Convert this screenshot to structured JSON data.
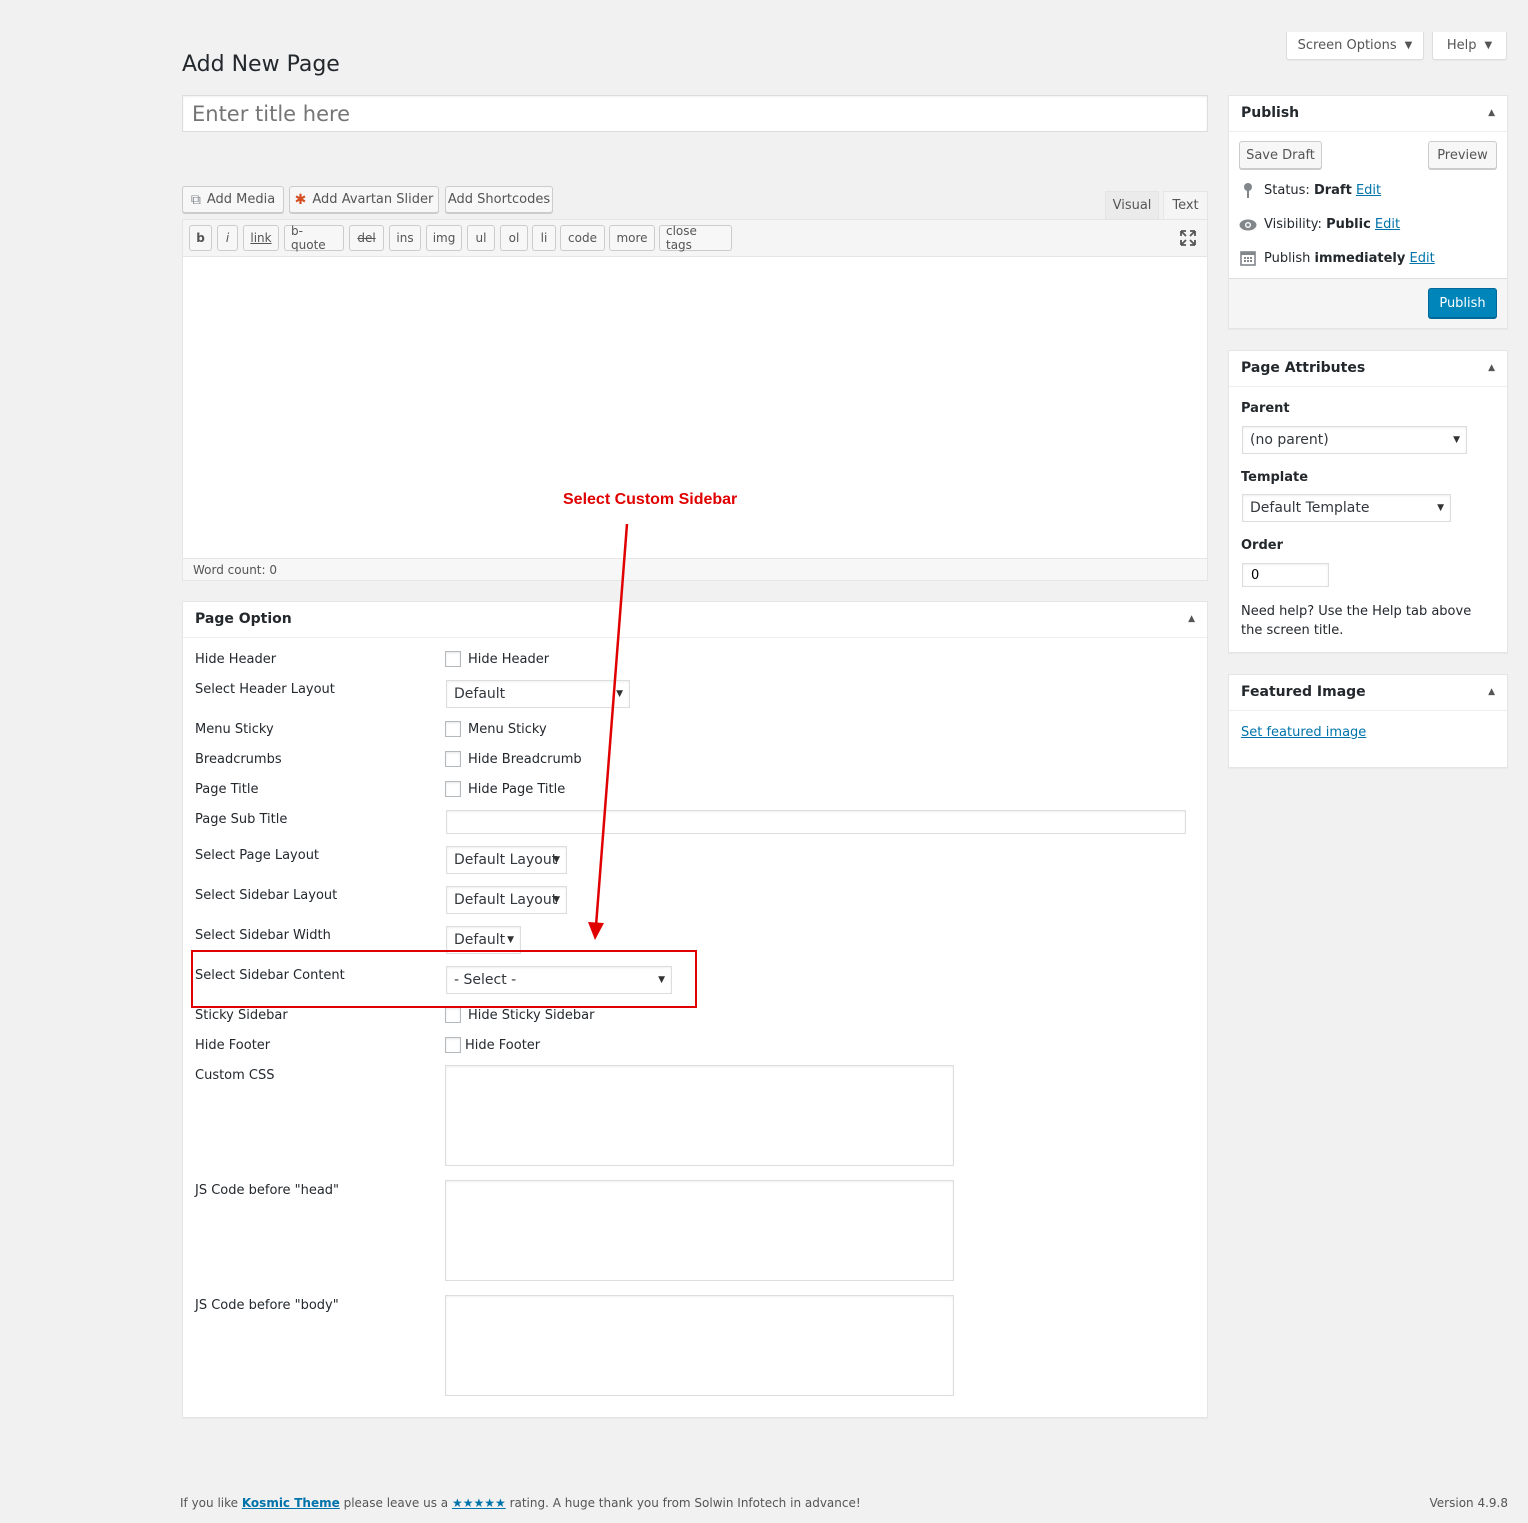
{
  "header": {
    "title": "Add New Page",
    "screen_options": "Screen Options",
    "help": "Help"
  },
  "title_input": {
    "placeholder": "Enter title here",
    "value": ""
  },
  "media_buttons": {
    "add_media": "Add Media",
    "add_slider": "Add Avartan Slider",
    "add_shortcodes": "Add Shortcodes"
  },
  "editor_tabs": {
    "visual": "Visual",
    "text": "Text"
  },
  "quicktags": [
    "b",
    "i",
    "link",
    "b-quote",
    "del",
    "ins",
    "img",
    "ul",
    "ol",
    "li",
    "code",
    "more",
    "close tags"
  ],
  "word_count": "Word count: 0",
  "page_option": {
    "title": "Page Option",
    "rows": {
      "hide_header": {
        "label": "Hide Header",
        "checkbox": "Hide Header"
      },
      "header_layout": {
        "label": "Select Header Layout",
        "value": "Default"
      },
      "menu_sticky": {
        "label": "Menu Sticky",
        "checkbox": "Menu Sticky"
      },
      "breadcrumbs": {
        "label": "Breadcrumbs",
        "checkbox": "Hide Breadcrumb"
      },
      "page_title": {
        "label": "Page Title",
        "checkbox": "Hide Page Title"
      },
      "page_sub_title": {
        "label": "Page Sub Title",
        "value": ""
      },
      "page_layout": {
        "label": "Select Page Layout",
        "value": "Default Layout"
      },
      "sidebar_layout": {
        "label": "Select Sidebar Layout",
        "value": "Default Layout"
      },
      "sidebar_width": {
        "label": "Select Sidebar Width",
        "value": "Default"
      },
      "sidebar_content": {
        "label": "Select Sidebar Content",
        "value": "- Select -"
      },
      "sticky_sidebar": {
        "label": "Sticky Sidebar",
        "checkbox": "Hide Sticky Sidebar"
      },
      "hide_footer": {
        "label": "Hide Footer",
        "checkbox": "Hide Footer"
      },
      "custom_css": {
        "label": "Custom CSS"
      },
      "js_head": {
        "label": "JS Code before \"head\""
      },
      "js_body": {
        "label": "JS Code before \"body\""
      }
    }
  },
  "annotation": {
    "text": "Select Custom Sidebar",
    "color": "#e00000"
  },
  "publish": {
    "title": "Publish",
    "save_draft": "Save Draft",
    "preview": "Preview",
    "status_label": "Status:",
    "status_value": "Draft",
    "visibility_label": "Visibility:",
    "visibility_value": "Public",
    "publish_label": "Publish",
    "publish_value": "immediately",
    "edit": "Edit",
    "publish_button": "Publish"
  },
  "page_attributes": {
    "title": "Page Attributes",
    "parent_label": "Parent",
    "parent_value": "(no parent)",
    "template_label": "Template",
    "template_value": "Default Template",
    "order_label": "Order",
    "order_value": "0",
    "help_text": "Need help? Use the Help tab above the screen title."
  },
  "featured_image": {
    "title": "Featured Image",
    "link": "Set featured image"
  },
  "footer": {
    "prefix": "If you like",
    "theme_link": "Kosmic Theme",
    "middle": "please leave us a",
    "stars": "★★★★★",
    "suffix": "rating. A huge thank you from Solwin Infotech in advance!",
    "version": "Version 4.9.8"
  },
  "colors": {
    "primary": "#0085ba",
    "link": "#0073aa",
    "annotation": "#e00000"
  }
}
